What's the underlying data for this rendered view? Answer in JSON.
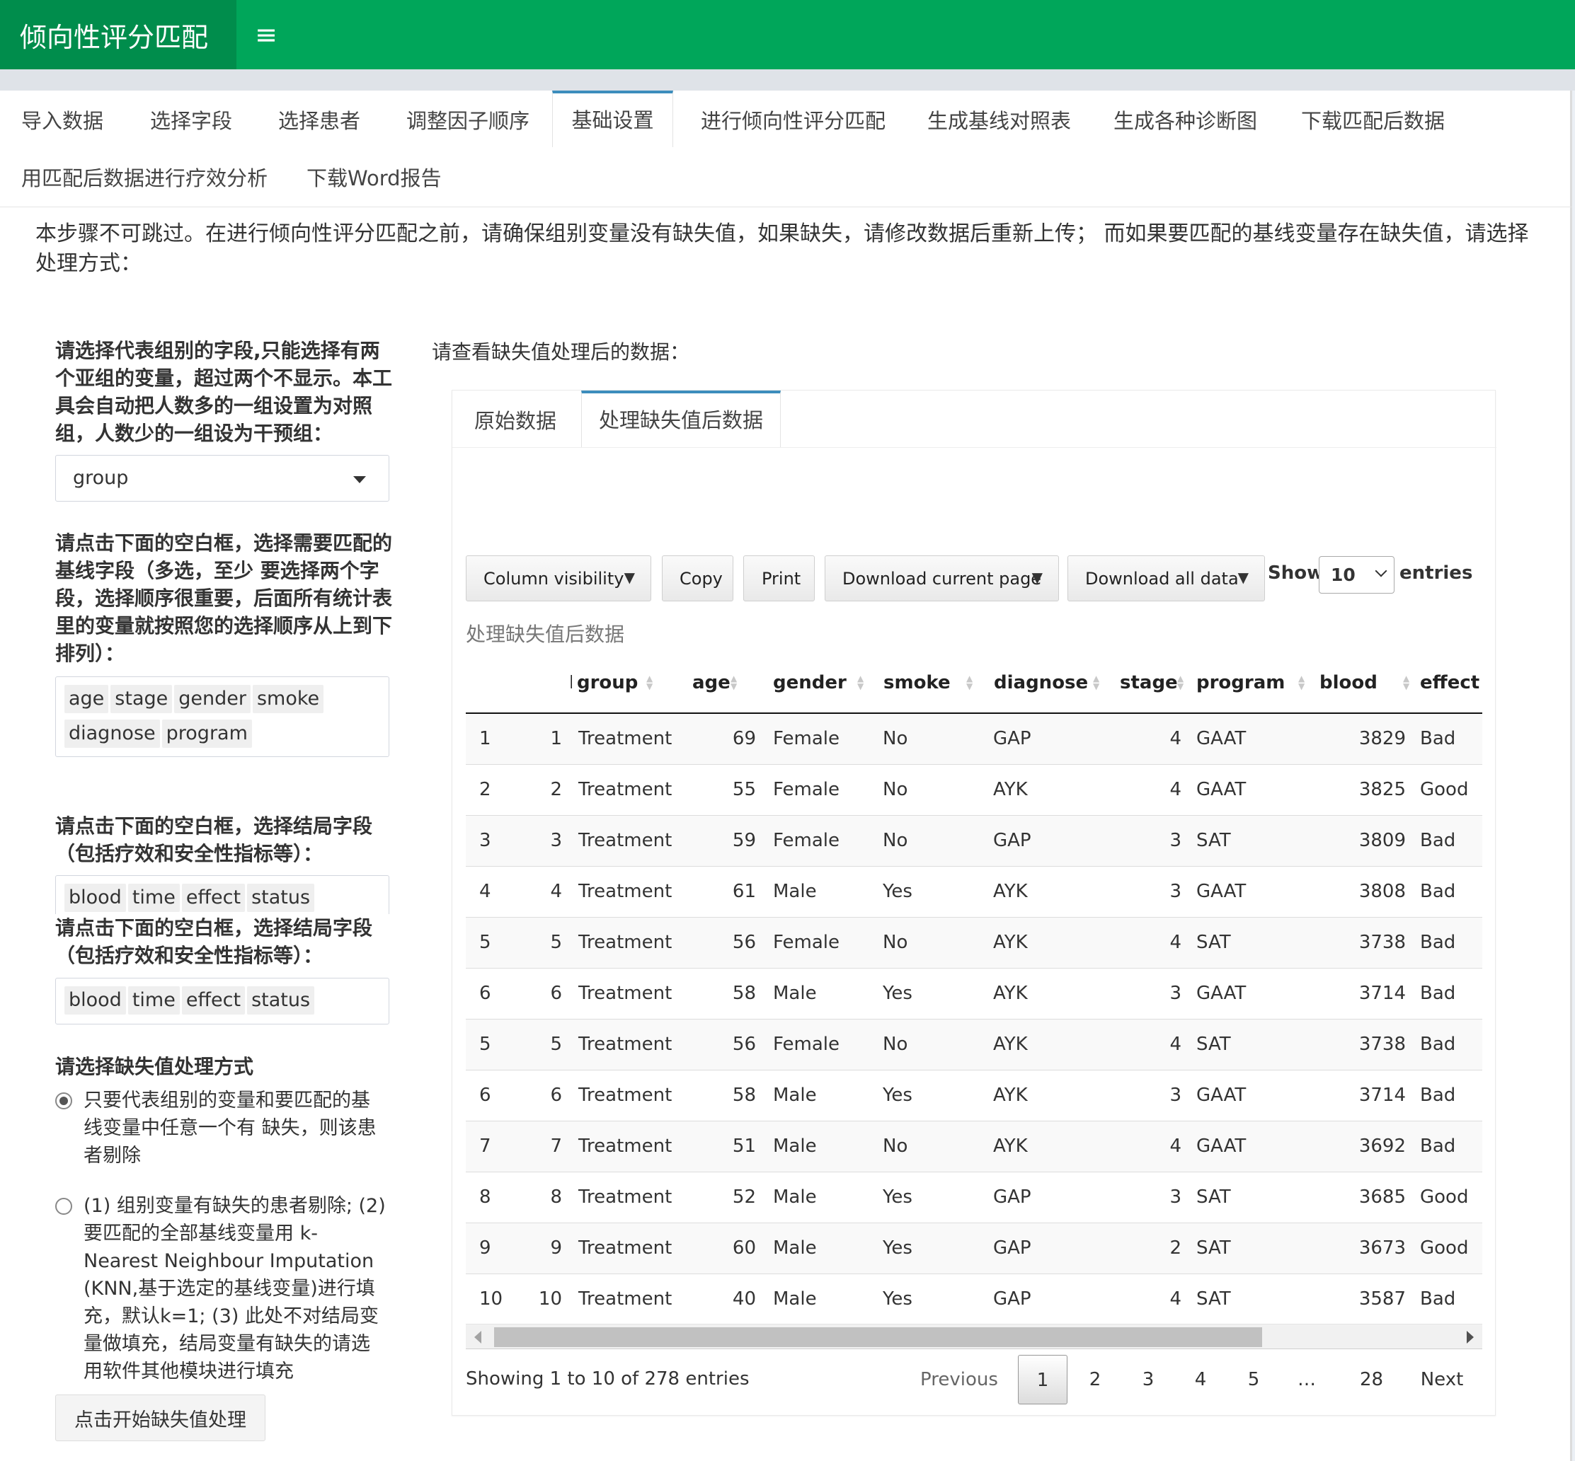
{
  "header": {
    "title": "倾向性评分匹配",
    "menu_icon": "≡"
  },
  "tabs": [
    {
      "label": "导入数据"
    },
    {
      "label": "选择字段"
    },
    {
      "label": "选择患者"
    },
    {
      "label": "调整因子顺序"
    },
    {
      "label": "基础设置",
      "active": true
    },
    {
      "label": "进行倾向性评分匹配"
    },
    {
      "label": "生成基线对照表"
    },
    {
      "label": "生成各种诊断图"
    },
    {
      "label": "下载匹配后数据"
    },
    {
      "label": "用匹配后数据进行疗效分析"
    },
    {
      "label": "下载Word报告"
    }
  ],
  "notice": "本步骤不可跳过。在进行倾向性评分匹配之前，请确保组别变量没有缺失值，如果缺失，请修改数据后重新上传； 而如果要匹配的基线变量存在缺失值，请选择处理方式：",
  "left": {
    "group_label": "请选择代表组别的字段,只能选择有两个亚组的变量，超过两个不显示。本工具会自动把人数多的一组设置为对照组，人数少的一组设为干预组：",
    "group_value": "group",
    "baseline_label": "请点击下面的空白框，选择需要匹配的基线字段（多选，至少 要选择两个字段，选择顺序很重要，后面所有统计表里的变量就按照您的选择顺序从上到下排列）：",
    "baseline_chips": [
      "age",
      "stage",
      "gender",
      "smoke",
      "diagnose",
      "program"
    ],
    "outcome_label_1": "请点击下面的空白框，选择结局字段（包括疗效和安全性指标等）：",
    "outcome_chips_1": [
      "blood",
      "time",
      "effect",
      "status"
    ],
    "outcome_label_2": "请点击下面的空白框，选择结局字段（包括疗效和安全性指标等）：",
    "outcome_chips_2": [
      "blood",
      "time",
      "effect",
      "status"
    ],
    "missing_label": "请选择缺失值处理方式",
    "option_1": "只要代表组别的变量和要匹配的基线变量中任意一个有 缺失，则该患者剔除",
    "option_2": "(1) 组别变量有缺失的患者剔除; (2) 要匹配的全部基线变量用 k-Nearest Neighbour Imputation (KNN,基于选定的基线变量)进行填充，默认k=1; (3) 此处不对结局变量做填充，结局变量有缺失的请选用软件其他模块进行填充",
    "selected_option": 1,
    "start_button": "点击开始缺失值处理"
  },
  "right": {
    "title": "请查看缺失值处理后的数据：",
    "subtabs": [
      {
        "label": "原始数据"
      },
      {
        "label": "处理缺失值后数据",
        "active": true
      }
    ],
    "buttons": {
      "colvis": "Column visibility",
      "copy": "Copy",
      "print": "Print",
      "download_page": "Download current page",
      "download_all": "Download all data"
    },
    "show_label": "Show",
    "entries_label": "entries",
    "page_length": "10",
    "caption": "处理缺失值后数据",
    "columns": [
      "",
      "ID",
      "group",
      "age",
      "gender",
      "smoke",
      "diagnose",
      "stage",
      "program",
      "blood",
      "effect"
    ],
    "rows": [
      [
        "1",
        "1",
        "Treatment",
        "69",
        "Female",
        "No",
        "GAP",
        "4",
        "GAAT",
        "3829",
        "Bad"
      ],
      [
        "2",
        "2",
        "Treatment",
        "55",
        "Female",
        "No",
        "AYK",
        "4",
        "GAAT",
        "3825",
        "Good"
      ],
      [
        "3",
        "3",
        "Treatment",
        "59",
        "Female",
        "No",
        "GAP",
        "3",
        "SAT",
        "3809",
        "Bad"
      ],
      [
        "4",
        "4",
        "Treatment",
        "61",
        "Male",
        "Yes",
        "AYK",
        "3",
        "GAAT",
        "3808",
        "Bad"
      ],
      [
        "5",
        "5",
        "Treatment",
        "56",
        "Female",
        "No",
        "AYK",
        "4",
        "SAT",
        "3738",
        "Bad"
      ],
      [
        "6",
        "6",
        "Treatment",
        "58",
        "Male",
        "Yes",
        "AYK",
        "3",
        "GAAT",
        "3714",
        "Bad"
      ],
      [
        "5",
        "5",
        "Treatment",
        "56",
        "Female",
        "No",
        "AYK",
        "4",
        "SAT",
        "3738",
        "Bad"
      ],
      [
        "6",
        "6",
        "Treatment",
        "58",
        "Male",
        "Yes",
        "AYK",
        "3",
        "GAAT",
        "3714",
        "Bad"
      ],
      [
        "7",
        "7",
        "Treatment",
        "51",
        "Male",
        "No",
        "AYK",
        "4",
        "GAAT",
        "3692",
        "Bad"
      ],
      [
        "8",
        "8",
        "Treatment",
        "52",
        "Male",
        "Yes",
        "GAP",
        "3",
        "SAT",
        "3685",
        "Good"
      ],
      [
        "9",
        "9",
        "Treatment",
        "60",
        "Male",
        "Yes",
        "GAP",
        "2",
        "SAT",
        "3673",
        "Good"
      ],
      [
        "10",
        "10",
        "Treatment",
        "40",
        "Male",
        "Yes",
        "GAP",
        "4",
        "SAT",
        "3587",
        "Bad"
      ]
    ],
    "info": "Showing 1 to 10 of 278 entries",
    "pagination": {
      "previous": "Previous",
      "pages": [
        "1",
        "2",
        "3",
        "4",
        "5",
        "…",
        "28"
      ],
      "current": "1",
      "next": "Next"
    }
  },
  "colors": {
    "header_bg": "#00a65a",
    "brand_bg": "#008d4c",
    "tab_active_border": "#3c8dbc"
  }
}
